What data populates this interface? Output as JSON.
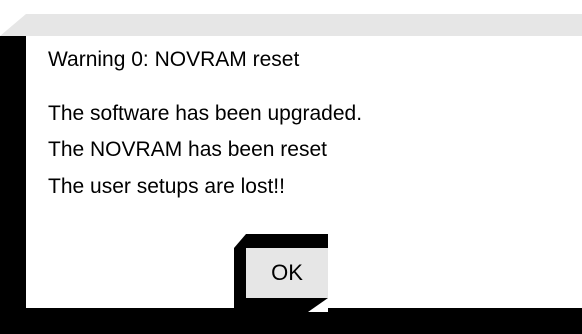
{
  "dialog": {
    "title": "Warning 0: NOVRAM reset",
    "lines": [
      "The software has been upgraded.",
      "The NOVRAM has been reset",
      "The user setups are lost!!"
    ],
    "ok_label": "OK"
  },
  "colors": {
    "frame": "#000000",
    "face": "#ffffff",
    "topbar": "#e6e6e6",
    "button_face": "#e6e6e6"
  }
}
